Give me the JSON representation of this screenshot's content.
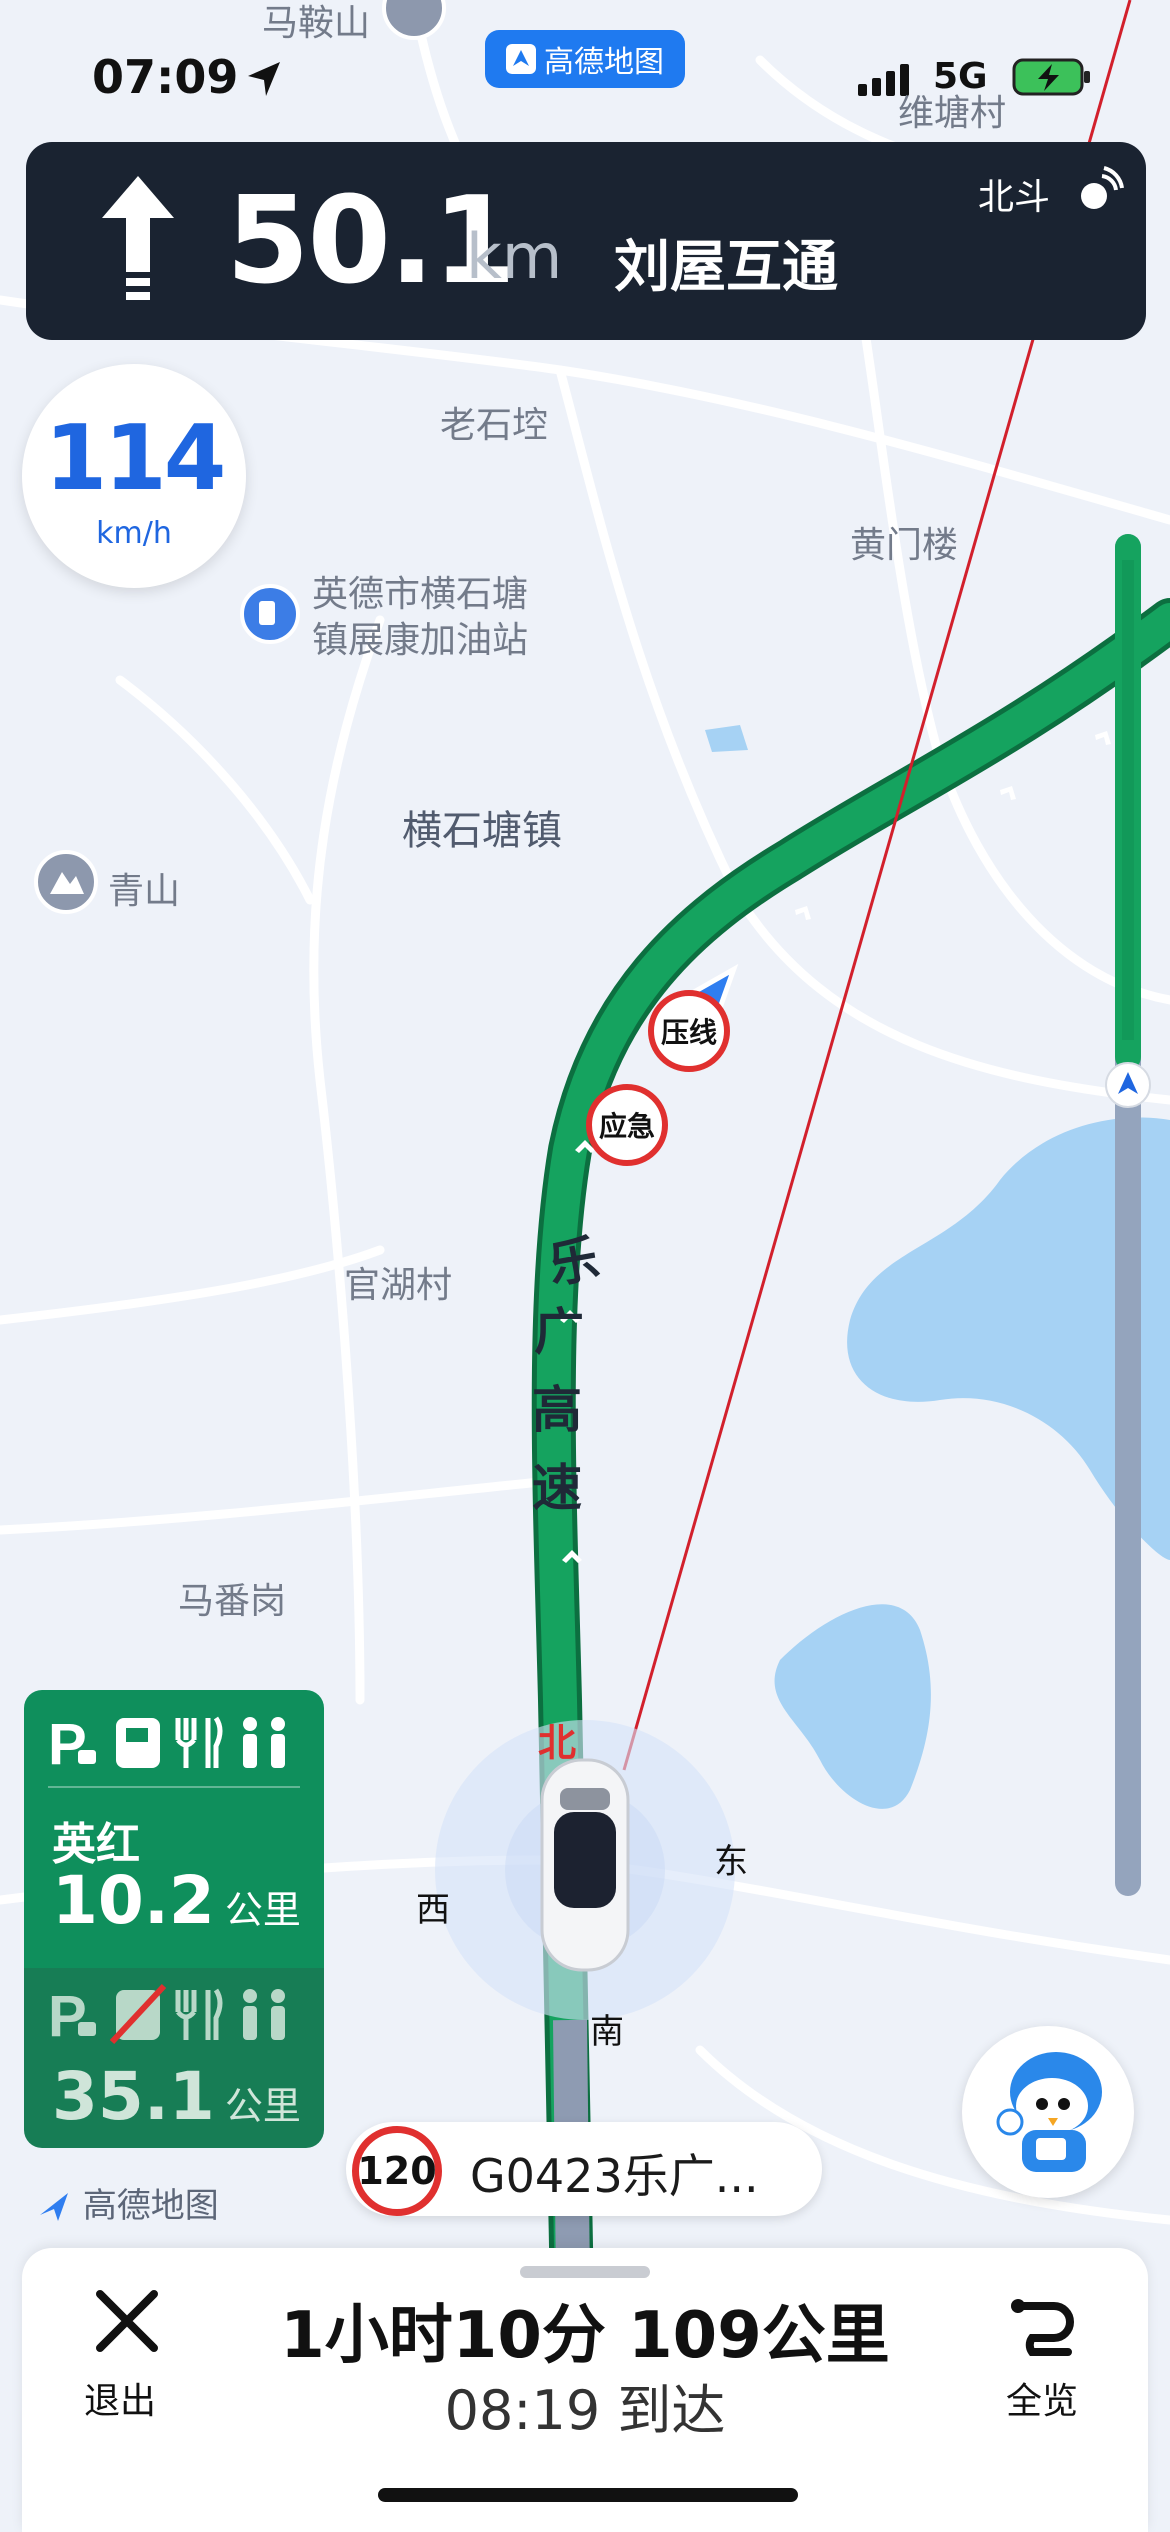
{
  "status_bar": {
    "time": "07:09",
    "network": "5G"
  },
  "app_badge": {
    "label": "高德地图"
  },
  "nav_banner": {
    "distance": "50.1",
    "unit": "km",
    "road": "刘屋互通",
    "gps_label": "北斗"
  },
  "speed": {
    "value": "114",
    "unit": "km/h"
  },
  "map_labels": {
    "ma_an_shan": "马鞍山",
    "wei_tang_cun": "维塘村",
    "lao_shi_keng": "老石埪",
    "huang_men_lou": "黄门楼",
    "gas_station_line1": "英德市横石塘",
    "gas_station_line2": "镇展康加油站",
    "heng_shi_tang": "横石塘镇",
    "qing_shan": "青山",
    "guan_hu_cun": "官湖村",
    "ma_fan_gang": "马番岗",
    "road_char1": "乐",
    "road_char2": "广",
    "road_char3": "高",
    "road_char4": "速",
    "sign_yaxian": "压线",
    "sign_yingji": "应急",
    "compass_n": "北",
    "compass_e": "东",
    "compass_s": "南",
    "compass_w": "西"
  },
  "service_area": {
    "first": {
      "name": "英红",
      "distance": "10.2",
      "unit": "公里"
    },
    "second": {
      "distance": "35.1",
      "unit": "公里"
    }
  },
  "road_info": {
    "speed_limit": "120",
    "road_name": "G0423乐广..."
  },
  "watermark": "高德地图",
  "bottom_sheet": {
    "exit_label": "退出",
    "overview_label": "全览",
    "trip_summary": "1小时10分  109公里",
    "eta": "08:19 到达"
  },
  "colors": {
    "route_green": "#15a35f",
    "banner_bg": "#1a2331",
    "accent_blue": "#1f66e0",
    "route_line_red": "#d2202c"
  }
}
